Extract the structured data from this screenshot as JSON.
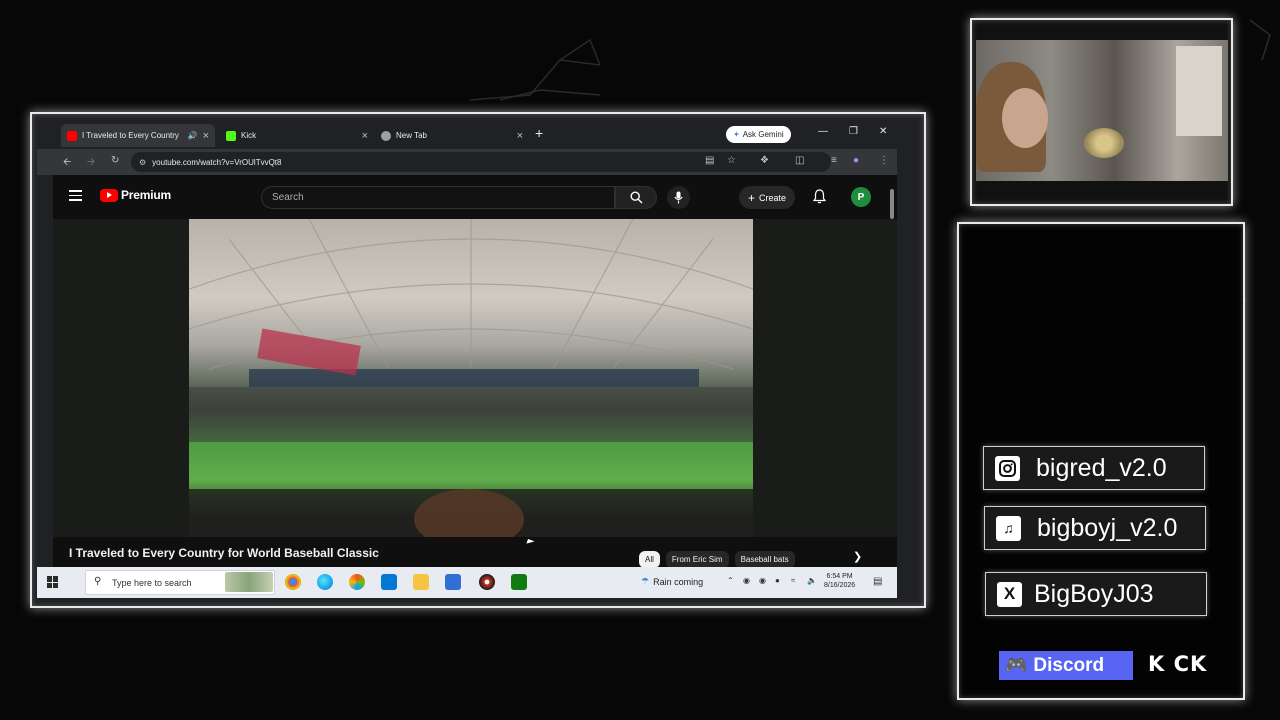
{
  "browser": {
    "tabs": [
      {
        "title": "I Traveled to Every Country",
        "active": true,
        "favicon_color": "#ff0000",
        "audio": true
      },
      {
        "title": "Kick",
        "active": false,
        "favicon_color": "#53fc18"
      },
      {
        "title": "New Tab",
        "active": false,
        "favicon_color": "#9aa0a6"
      }
    ],
    "new_tab_label": "+",
    "gemini_label": "Ask Gemini",
    "url": "youtube.com/watch?v=VrOUlTvvQt8"
  },
  "youtube": {
    "logo_text": "Premium",
    "search_placeholder": "Search",
    "create_label": "Create",
    "avatar_letter": "P",
    "video_title": "I Traveled to Every Country for World Baseball Classic",
    "chips": [
      "All",
      "From Eric Sim",
      "Baseball bats"
    ]
  },
  "taskbar": {
    "search_placeholder": "Type here to search",
    "weather_text": "Rain coming",
    "time": "6:54 PM",
    "date": "8/16/2026"
  },
  "socials": {
    "instagram": "bigred_v2.0",
    "tiktok": "bigboyj_v2.0",
    "x": "BigBoyJ03",
    "discord": "Discord",
    "kick": "K CK"
  },
  "colors": {
    "youtube_red": "#ff0000",
    "avatar_green": "#1e8e3e",
    "discord_blurple": "#5865f2"
  }
}
